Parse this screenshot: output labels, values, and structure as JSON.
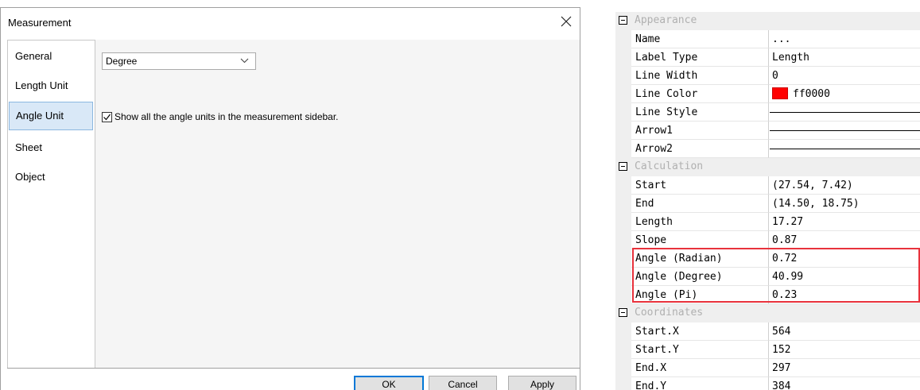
{
  "dialog": {
    "title": "Measurement",
    "sidebar": [
      {
        "label": "General",
        "active": false
      },
      {
        "label": "Length Unit",
        "active": false
      },
      {
        "label": "Angle Unit",
        "active": true
      },
      {
        "label": "Sheet",
        "active": false
      },
      {
        "label": "Object",
        "active": false
      }
    ],
    "angle_unit": {
      "selected": "Degree",
      "checkbox_label": "Show all the angle units in the measurement sidebar.",
      "checked": true
    },
    "buttons": {
      "ok": "OK",
      "cancel": "Cancel",
      "apply": "Apply"
    }
  },
  "properties": {
    "appearance": {
      "title": "Appearance",
      "name_label": "Name",
      "name_value": "...",
      "label_type_label": "Label Type",
      "label_type_value": "Length",
      "line_width_label": "Line Width",
      "line_width_value": "0",
      "line_color_label": "Line Color",
      "line_color_value": "ff0000",
      "line_color_hex": "#ff0000",
      "line_style_label": "Line Style",
      "arrow1_label": "Arrow1",
      "arrow2_label": "Arrow2"
    },
    "calculation": {
      "title": "Calculation",
      "start_label": "Start",
      "start_value": "(27.54, 7.42)",
      "end_label": "End",
      "end_value": "(14.50, 18.75)",
      "length_label": "Length",
      "length_value": "17.27",
      "slope_label": "Slope",
      "slope_value": "0.87",
      "angle_rad_label": "Angle (Radian)",
      "angle_rad_value": "0.72",
      "angle_deg_label": "Angle (Degree)",
      "angle_deg_value": "40.99",
      "angle_pi_label": "Angle (Pi)",
      "angle_pi_value": "0.23"
    },
    "coordinates": {
      "title": "Coordinates",
      "start_x_label": "Start.X",
      "start_x_value": "564",
      "start_y_label": "Start.Y",
      "start_y_value": "152",
      "end_x_label": "End.X",
      "end_x_value": "297",
      "end_y_label": "End.Y",
      "end_y_value": "384"
    }
  },
  "colors": {
    "highlight": "#e8323c",
    "selection": "#d9e8f7",
    "accent": "#0078d7"
  }
}
